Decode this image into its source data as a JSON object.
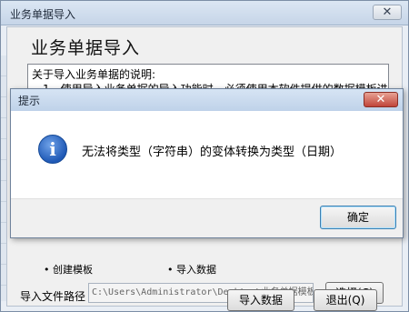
{
  "window": {
    "title": "业务单据导入",
    "close_glyph": "✕",
    "heading": "业务单据导入"
  },
  "description": {
    "title": "关于导入业务单据的说明:",
    "line1": "1、使用导入业务单据的导入功能时，必须使用本软件提供的数据模板进"
  },
  "bullets": {
    "left": "• 创建模板",
    "right": "• 导入数据"
  },
  "import_path": {
    "label": "导入文件路径",
    "value": "C:\\Users\\Administrator\\Desktop\\业务单据模板"
  },
  "buttons": {
    "choose": "选择(C)",
    "import": "导入数据",
    "exit": "退出(Q)"
  },
  "message_box": {
    "title": "提示",
    "close_glyph": "✕",
    "icon": "info-icon",
    "icon_glyph": "i",
    "text": "无法将类型（字符串）的变体转换为类型（日期）",
    "ok_label": "确定"
  }
}
